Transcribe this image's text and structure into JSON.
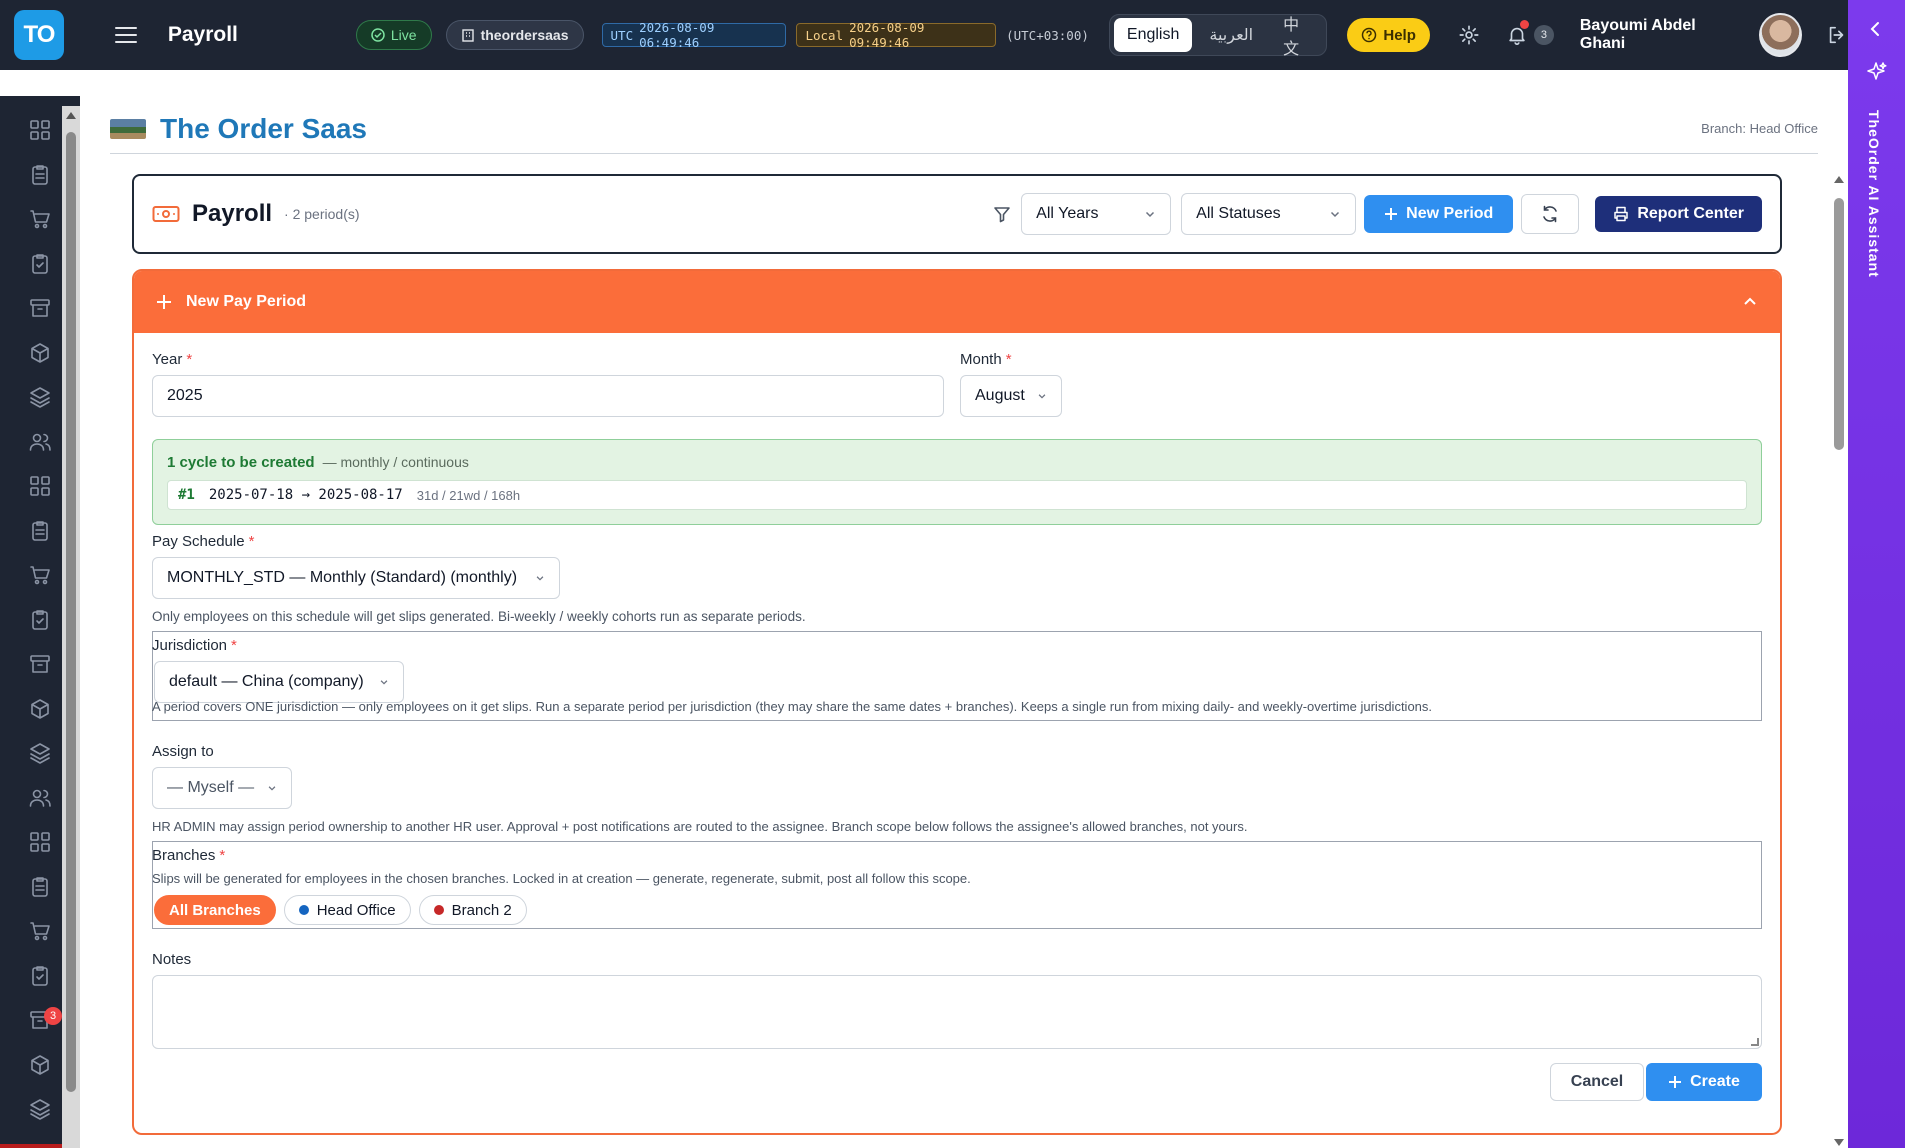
{
  "topbar": {
    "logo_text": "TO",
    "app_title": "Payroll",
    "live_label": "Live",
    "tenant_label": "theordersaas",
    "utc_prefix": "UTC",
    "utc_time": "2026-08-09 06:49:46",
    "local_prefix": "Local",
    "local_time": "2026-08-09 09:49:46",
    "tz_offset": "(UTC+03:00)",
    "languages": [
      "English",
      "العربية",
      "中文"
    ],
    "active_language": "English",
    "help_label": "Help",
    "notification_count": "3",
    "user_name": "Bayoumi Abdel Ghani"
  },
  "sidebar": {
    "icons": [
      "dashboard-icon",
      "clipboard-icon",
      "cart-icon",
      "checklist-icon",
      "archive-icon",
      "package-icon",
      "layers-icon",
      "users-icon",
      "badge-icon",
      "accessibility-icon",
      "ship-icon",
      "dollar-doc-icon",
      "wallet-icon",
      "bank-icon",
      "document-icon",
      "book-icon",
      "dollar-icon",
      "chart-icon",
      "coins-icon",
      "inbox-icon",
      "megaphone-icon",
      "team-icon",
      "calendar-clock-icon"
    ],
    "badge_count": "3"
  },
  "assistant": {
    "label": "TheOrder AI Assistant"
  },
  "company": {
    "name": "The Order Saas",
    "branch": "Branch: Head Office"
  },
  "header": {
    "title": "Payroll",
    "period_count": "· 2 period(s)",
    "year_filter": "All Years",
    "status_filter": "All Statuses",
    "new_period_label": "New Period",
    "report_center_label": "Report Center"
  },
  "form": {
    "title": "New Pay Period",
    "year_label": "Year",
    "year_value": "2025",
    "month_label": "Month",
    "month_value": "August",
    "cycles_title": "1 cycle to be created",
    "cycles_sub": "— monthly / continuous",
    "cycle": {
      "num": "#1",
      "range": "2025-07-18 → 2025-08-17",
      "meta": "31d / 21wd / 168h"
    },
    "schedule_label": "Pay Schedule",
    "schedule_value": "MONTHLY_STD — Monthly (Standard) (monthly)",
    "schedule_help": "Only employees on this schedule will get slips generated. Bi-weekly / weekly cohorts run as separate periods.",
    "jurisdiction_label": "Jurisdiction",
    "jurisdiction_value": "default — China (company)",
    "jurisdiction_help": "A period covers ONE jurisdiction — only employees on it get slips. Run a separate period per jurisdiction (they may share the same dates + branches). Keeps a single run from mixing daily- and weekly-overtime jurisdictions.",
    "assign_label": "Assign to",
    "assign_value": "— Myself —",
    "assign_help": "HR ADMIN may assign period ownership to another HR user. Approval + post notifications are routed to the assignee. Branch scope below follows the assignee's allowed branches, not yours.",
    "branches_label": "Branches",
    "branches_help": "Slips will be generated for employees in the chosen branches. Locked in at creation — generate, regenerate, submit, post all follow this scope.",
    "branches": [
      {
        "label": "All Branches",
        "color": ""
      },
      {
        "label": "Head Office",
        "color": "#1565c0"
      },
      {
        "label": "Branch 2",
        "color": "#c62828"
      }
    ],
    "notes_label": "Notes",
    "notes_value": "",
    "cancel_label": "Cancel",
    "create_label": "Create"
  }
}
